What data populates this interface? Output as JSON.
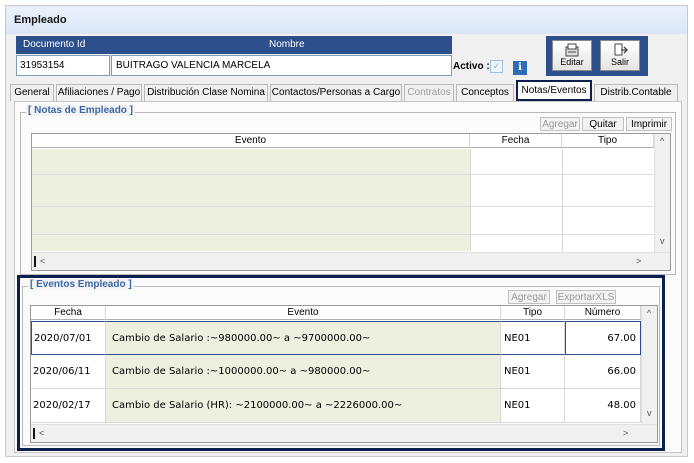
{
  "window": {
    "title": "Empleado"
  },
  "header": {
    "doc_label": "Documento Id",
    "name_label": "Nombre",
    "doc_value": "31953154",
    "name_value": "BUITRAGO VALENCIA MARCELA",
    "activo_label": "Activo :",
    "activo_mark": "✓",
    "info_mark": "i",
    "edit_label": "Editar",
    "exit_label": "Salir"
  },
  "tabs": [
    {
      "label": "General"
    },
    {
      "label": "Afiliaciones / Pago"
    },
    {
      "label": "Distribución Clase Nomina"
    },
    {
      "label": "Contactos/Personas a Cargo"
    },
    {
      "label": "Contratos"
    },
    {
      "label": "Conceptos"
    },
    {
      "label": "Notas/Eventos"
    },
    {
      "label": "Distrib.Contable"
    }
  ],
  "notas": {
    "title": "[ Notas de Empleado ]",
    "btn_add": "Agregar",
    "btn_remove": "Quitar",
    "btn_print": "Imprimir",
    "col_event": "Evento",
    "col_date": "Fecha",
    "col_type": "Tipo"
  },
  "eventos": {
    "title": "[ Eventos Empleado ]",
    "btn_add": "Agregar",
    "btn_export": "ExportarXLS",
    "col_date": "Fecha",
    "col_event": "Evento",
    "col_type": "Tipo",
    "col_number": "Número",
    "rows": [
      {
        "date": "2020/07/01",
        "event": "Cambio de Salario :~980000.00~ a ~9700000.00~",
        "type": "NE01",
        "number": "67.00"
      },
      {
        "date": "2020/06/11",
        "event": "Cambio de Salario :~1000000.00~ a ~980000.00~",
        "type": "NE01",
        "number": "66.00"
      },
      {
        "date": "2020/02/17",
        "event": "Cambio de Salario (HR): ~2100000.00~ a ~2226000.00~",
        "type": "NE01",
        "number": "48.00"
      }
    ]
  },
  "scroll": {
    "up": "^",
    "down": "v",
    "left": "<",
    "right": ">"
  }
}
